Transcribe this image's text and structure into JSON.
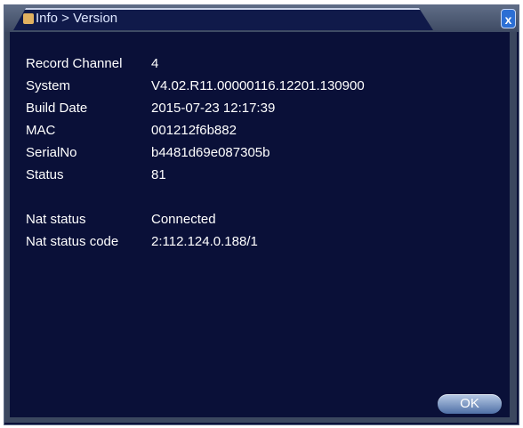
{
  "window": {
    "title": "Info > Version",
    "close_symbol": "x"
  },
  "info": [
    {
      "label": "Record Channel",
      "value": "4"
    },
    {
      "label": "System",
      "value": "V4.02.R11.00000116.12201.130900"
    },
    {
      "label": "Build Date",
      "value": "2015-07-23 12:17:39"
    },
    {
      "label": "MAC",
      "value": "001212f6b882"
    },
    {
      "label": "SerialNo",
      "value": "b4481d69e087305b"
    },
    {
      "label": "Status",
      "value": "81"
    }
  ],
  "nat": [
    {
      "label": "Nat status",
      "value": "Connected"
    },
    {
      "label": "Nat status code",
      "value": "2:112.124.0.188/1"
    }
  ],
  "buttons": {
    "ok_label": "OK"
  },
  "colors": {
    "background": "#0a1038",
    "frame": "#3b475f",
    "text": "#ffffff",
    "close": "#2c6fd4"
  },
  "icons": {
    "title_icon": "folder-icon",
    "close_icon": "close-icon"
  }
}
